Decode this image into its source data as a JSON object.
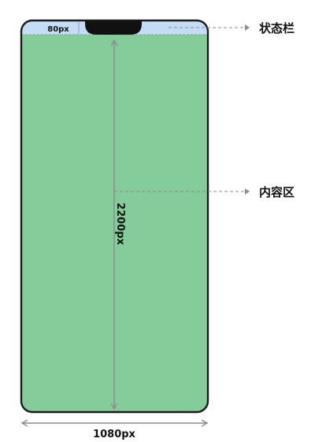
{
  "status_bar_height_label": "80px",
  "content_height_label": "2200px",
  "screen_width_label": "1080px",
  "status_bar_callout": "状态栏",
  "content_area_callout": "内容区",
  "colors": {
    "status_bar": "#c4dcf5",
    "content_area": "#84cc9a",
    "phone_frame": "#1a1a1a",
    "notch": "#111111",
    "dimension_line": "#8c8c8c",
    "callout_line": "#8c8c8c"
  }
}
